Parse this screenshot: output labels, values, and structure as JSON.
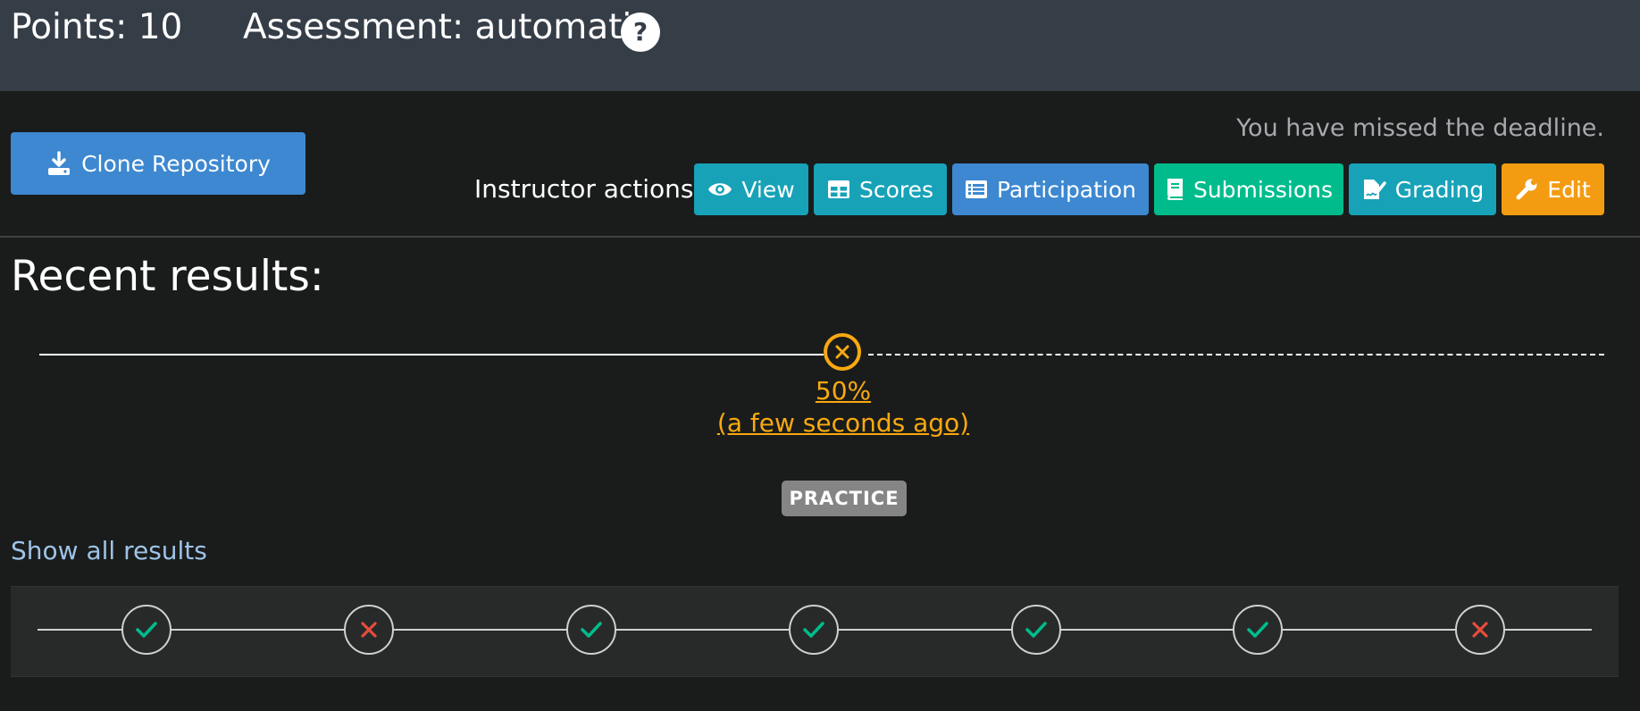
{
  "header": {
    "points": "Points: 10",
    "assessment": "Assessment: automatic",
    "help_icon": "question-circle-icon"
  },
  "clone_button": {
    "label": "Clone Repository",
    "icon": "download-icon",
    "color": "#3d88d0"
  },
  "deadline_notice": "You have missed the deadline.",
  "instructor_actions": {
    "label": "Instructor actions:",
    "buttons": [
      {
        "label": "View",
        "icon": "eye-icon",
        "color": "#17a2b8"
      },
      {
        "label": "Scores",
        "icon": "table-icon",
        "color": "#17a2b8"
      },
      {
        "label": "Participation",
        "icon": "list-alt-icon",
        "color": "#3d88d0"
      },
      {
        "label": "Submissions",
        "icon": "book-icon",
        "color": "#00bc8c"
      },
      {
        "label": "Grading",
        "icon": "signature-icon",
        "color": "#17a2b8"
      },
      {
        "label": "Edit",
        "icon": "wrench-icon",
        "color": "#f39c12"
      }
    ]
  },
  "recent_results": {
    "title": "Recent results:",
    "latest": {
      "score": "50%",
      "time": "(a few seconds ago)",
      "status": "failed",
      "badge": "PRACTICE",
      "color": "#f9a90f"
    }
  },
  "show_all_results": "Show all results",
  "result_history": [
    {
      "status": "success",
      "icon": "check-icon",
      "color": "#00bc8c"
    },
    {
      "status": "failed",
      "icon": "times-icon",
      "color": "#e74c3c"
    },
    {
      "status": "success",
      "icon": "check-icon",
      "color": "#00bc8c"
    },
    {
      "status": "success",
      "icon": "check-icon",
      "color": "#00bc8c"
    },
    {
      "status": "success",
      "icon": "check-icon",
      "color": "#00bc8c"
    },
    {
      "status": "success",
      "icon": "check-icon",
      "color": "#00bc8c"
    },
    {
      "status": "failed",
      "icon": "times-icon",
      "color": "#e74c3c"
    }
  ]
}
